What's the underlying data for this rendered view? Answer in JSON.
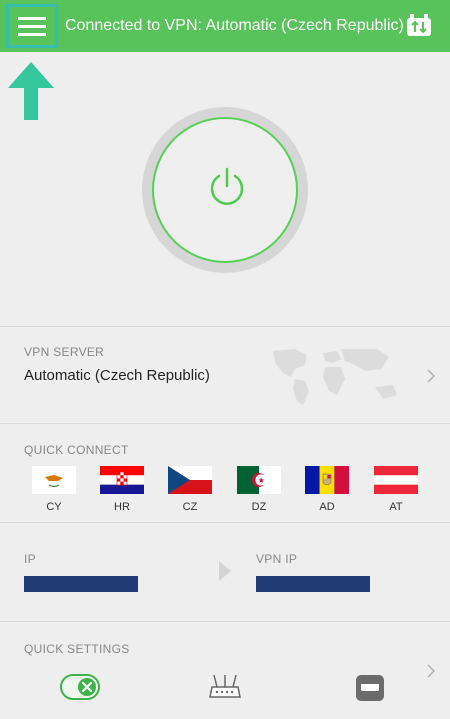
{
  "topbar": {
    "title": "Connected to VPN: Automatic (Czech Republic)",
    "menu_icon": "hamburger-menu-icon",
    "switch_icon": "switch-server-icon",
    "bg_color": "#58c35a"
  },
  "power": {
    "icon": "power-icon",
    "ring_color": "#56d156"
  },
  "vpn_server": {
    "label": "VPN SERVER",
    "value": "Automatic (Czech Republic)"
  },
  "quick_connect": {
    "label": "QUICK CONNECT",
    "countries": [
      {
        "code": "CY"
      },
      {
        "code": "HR"
      },
      {
        "code": "CZ"
      },
      {
        "code": "DZ"
      },
      {
        "code": "AD"
      },
      {
        "code": "AT"
      }
    ]
  },
  "ip": {
    "ip_label": "IP",
    "vpn_ip_label": "VPN IP",
    "redaction_color": "#213c74"
  },
  "quick_settings": {
    "label": "QUICK SETTINGS",
    "items": [
      {
        "icon": "kill-switch-toggle-icon"
      },
      {
        "icon": "router-icon"
      },
      {
        "icon": "ad-blocker-icon"
      }
    ]
  }
}
